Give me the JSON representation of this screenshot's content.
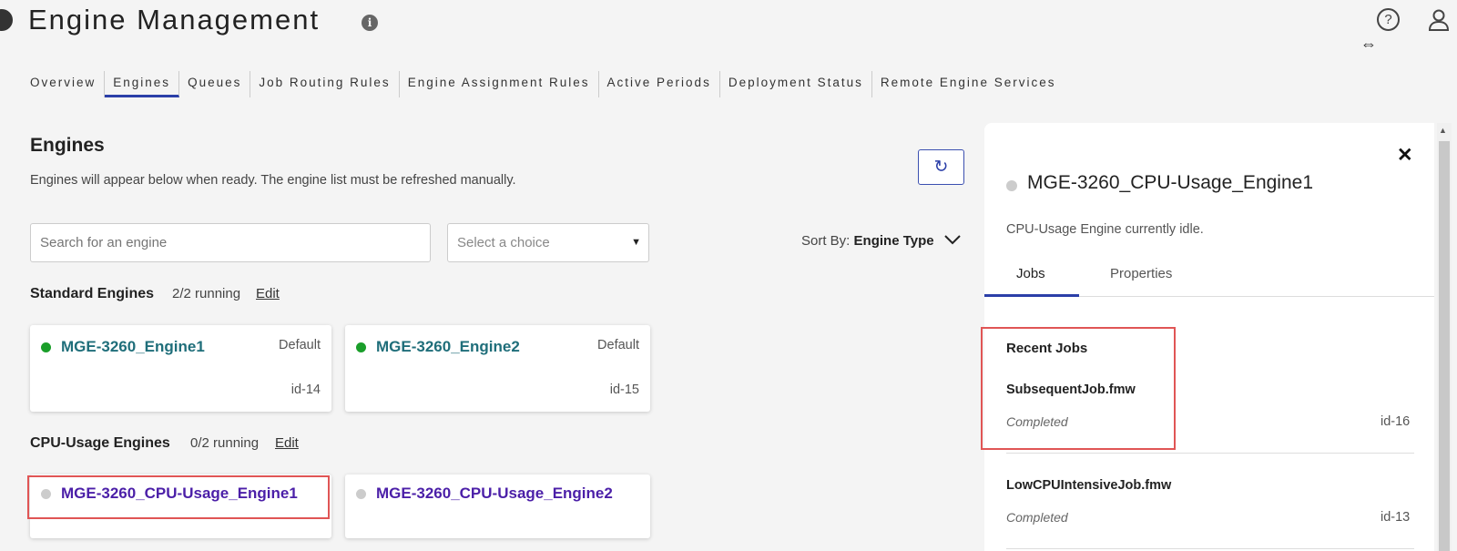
{
  "header": {
    "title": "Engine Management",
    "info_icon": "info-icon",
    "help_icon": "help-icon",
    "user_icon": "user-icon"
  },
  "tabs": [
    {
      "label": "Overview",
      "active": false
    },
    {
      "label": "Engines",
      "active": true
    },
    {
      "label": "Queues",
      "active": false
    },
    {
      "label": "Job Routing Rules",
      "active": false
    },
    {
      "label": "Engine Assignment Rules",
      "active": false
    },
    {
      "label": "Active Periods",
      "active": false
    },
    {
      "label": "Deployment Status",
      "active": false
    },
    {
      "label": "Remote Engine Services",
      "active": false
    }
  ],
  "engines_section": {
    "title": "Engines",
    "subtitle": "Engines will appear below when ready. The engine list must be refreshed manually.",
    "refresh_icon": "refresh-icon",
    "search_placeholder": "Search for an engine",
    "select_placeholder": "Select a choice",
    "sort_label": "Sort By:",
    "sort_value": "Engine Type"
  },
  "standard_group": {
    "title": "Standard Engines",
    "count": "2/2 running",
    "edit": "Edit",
    "engines": [
      {
        "name": "MGE-3260_Engine1",
        "tag": "Default",
        "id": "id-14",
        "status_color": "#1a9e2a"
      },
      {
        "name": "MGE-3260_Engine2",
        "tag": "Default",
        "id": "id-15",
        "status_color": "#1a9e2a"
      }
    ]
  },
  "cpu_group": {
    "title": "CPU-Usage Engines",
    "count": "0/2 running",
    "edit": "Edit",
    "engines": [
      {
        "name": "MGE-3260_CPU-Usage_Engine1",
        "status_color": "#cccccc"
      },
      {
        "name": "MGE-3260_CPU-Usage_Engine2",
        "status_color": "#cccccc"
      }
    ]
  },
  "side_panel": {
    "title": "MGE-3260_CPU-Usage_Engine1",
    "description": "CPU-Usage Engine currently idle.",
    "tabs": [
      "Jobs",
      "Properties"
    ],
    "recent_jobs_title": "Recent Jobs",
    "jobs": [
      {
        "name": "SubsequentJob.fmw",
        "status": "Completed",
        "id": "id-16"
      },
      {
        "name": "LowCPUIntensiveJob.fmw",
        "status": "Completed",
        "id": "id-13"
      }
    ]
  },
  "colors": {
    "accent": "#2b3fa8",
    "running_link": "#1f6e7a",
    "idle_link": "#4b1fa8",
    "highlight": "#e05555"
  }
}
